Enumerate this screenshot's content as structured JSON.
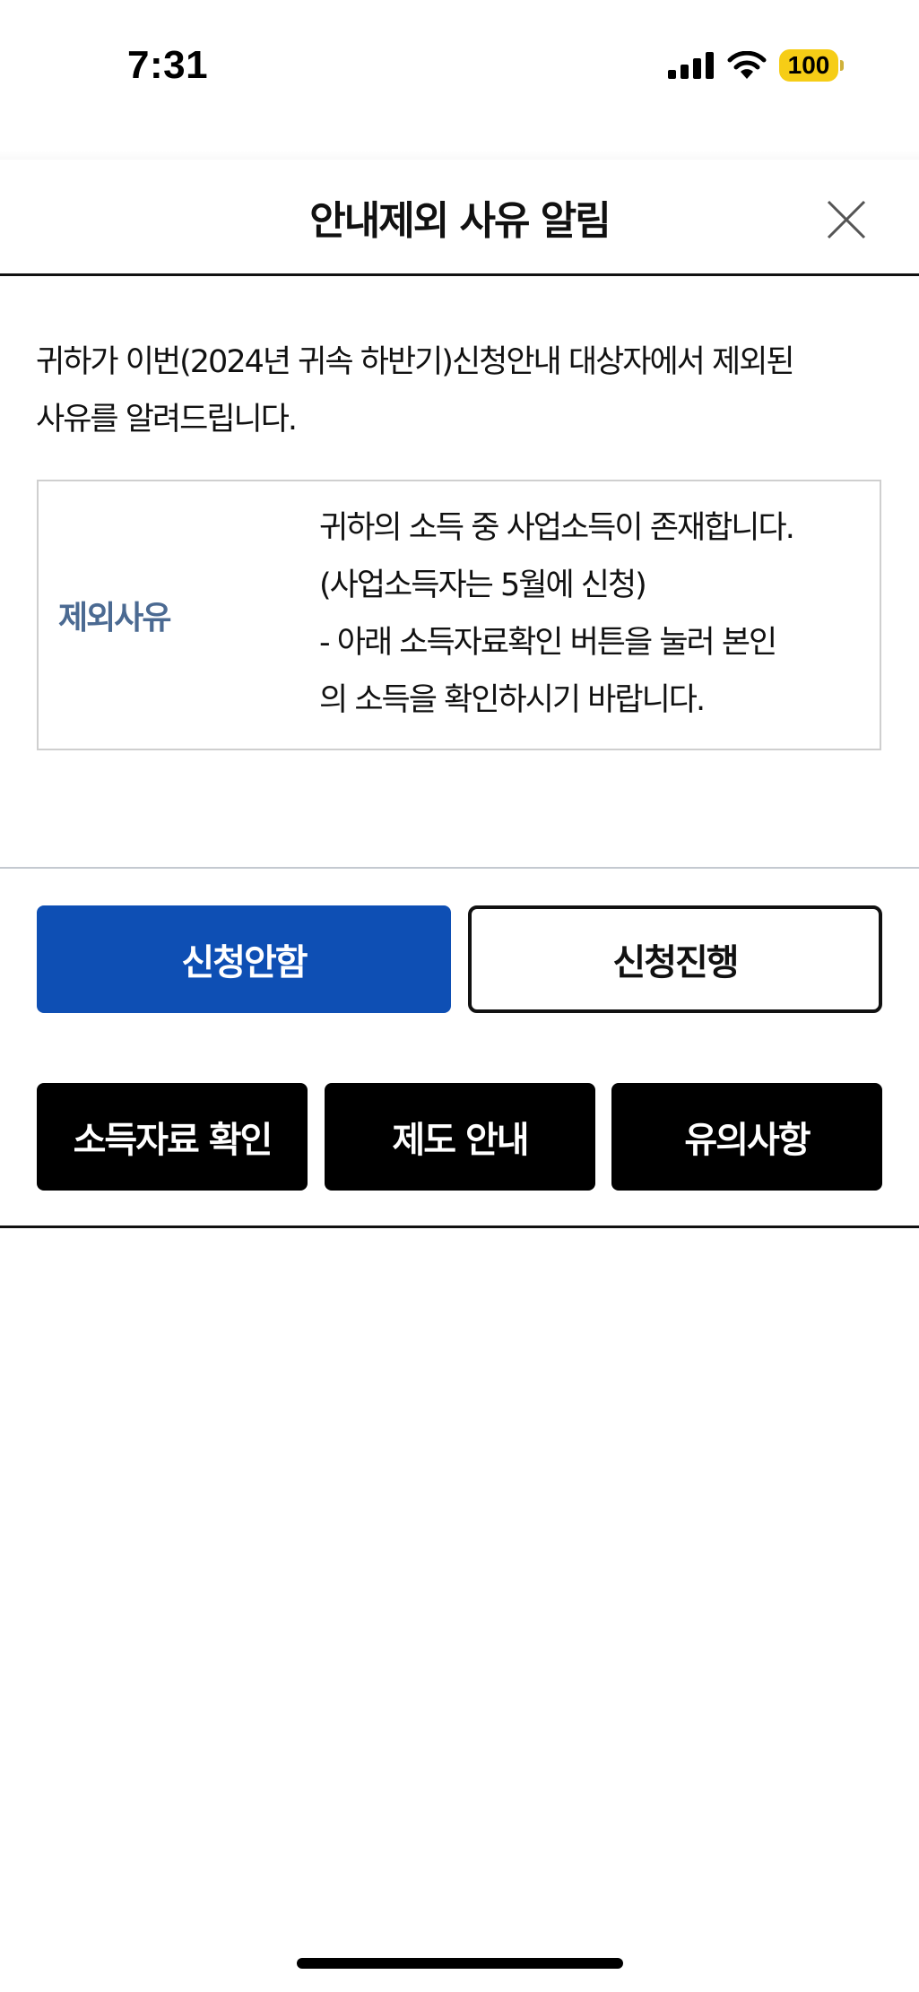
{
  "status_bar": {
    "time": "7:31",
    "battery": "100",
    "icons": [
      "signal-icon",
      "wifi-icon",
      "battery-icon"
    ],
    "battery_color": "#f6cd16"
  },
  "sheet": {
    "title": "안내제외 사유 알림",
    "close_icon": "close-icon"
  },
  "intro": {
    "line1": "귀하가 이번(2024년 귀속 하반기)신청안내 대상자에서 제외된",
    "line2": "사유를 알려드립니다."
  },
  "reason": {
    "label": "제외사유",
    "lines": [
      "귀하의 소득 중 사업소득이 존재합니다.",
      "(사업소득자는 5월에 신청)",
      "- 아래 소득자료확인 버튼을 눌러 본인",
      "의 소득을 확인하시기 바랍니다."
    ]
  },
  "actions": {
    "decline_label": "신청안함",
    "proceed_label": "신청진행"
  },
  "links": {
    "income_label": "소득자료 확인",
    "system_label": "제도 안내",
    "notice_label": "유의사항"
  },
  "colors": {
    "primary_blue": "#0e4fb4",
    "label_blue": "#4b6a92",
    "black": "#000000"
  }
}
